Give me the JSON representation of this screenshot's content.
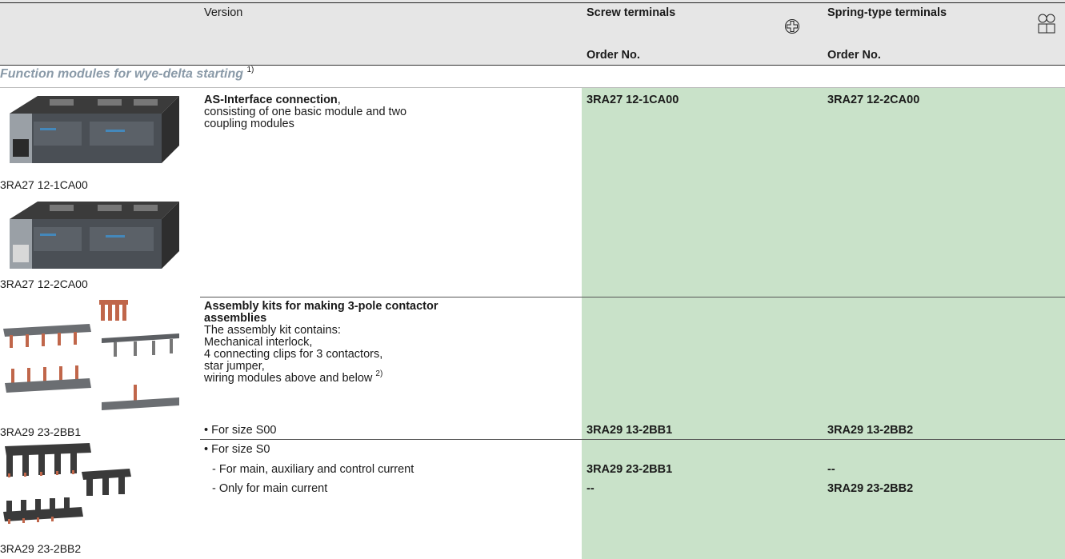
{
  "header": {
    "version": "Version",
    "screw_terminals": "Screw terminals",
    "spring_terminals": "Spring-type terminals",
    "order_no_screw": "Order No.",
    "order_no_spring": "Order No."
  },
  "section": {
    "title": "Function modules for wye-delta starting",
    "footnote": "1)"
  },
  "row1": {
    "image_caption_1": "3RA27 12-1CA00",
    "image_caption_2": "3RA27 12-2CA00",
    "title": "AS-Interface connection",
    "title_suffix": ",",
    "desc_line1": "consisting of one basic module and two",
    "desc_line2": "coupling modules",
    "screw": "3RA27 12-1CA00",
    "spring": "3RA27 12-2CA00"
  },
  "row2": {
    "image_caption": "3RA29 23-2BB1",
    "title_line1": "Assembly kits for making 3-pole contactor",
    "title_line2": "assemblies",
    "lines": [
      "The assembly kit contains:",
      "Mechanical interlock,",
      "4 connecting clips for 3 contactors,",
      "star jumper,"
    ],
    "last_line": "wiring modules above and below",
    "last_footnote": "2)",
    "item_s00": "• For size S00",
    "screw_s00": "3RA29 13-2BB1",
    "spring_s00": "3RA29 13-2BB2"
  },
  "row3": {
    "image_caption": "3RA29 23-2BB2",
    "item_s0": "• For size S0",
    "sub1": "- For main, auxiliary and control current",
    "sub1_screw": "3RA29 23-2BB1",
    "sub1_spring": "--",
    "sub2": "- Only for main current",
    "sub2_screw": "--",
    "sub2_spring": "3RA29 23-2BB2"
  },
  "icons": [
    "screw-terminal-icon",
    "spring-terminal-icon"
  ],
  "colors": {
    "header_band": "#e6e6e6",
    "order_column": "#c9e2c9",
    "section_title": "#8a9aa8"
  }
}
